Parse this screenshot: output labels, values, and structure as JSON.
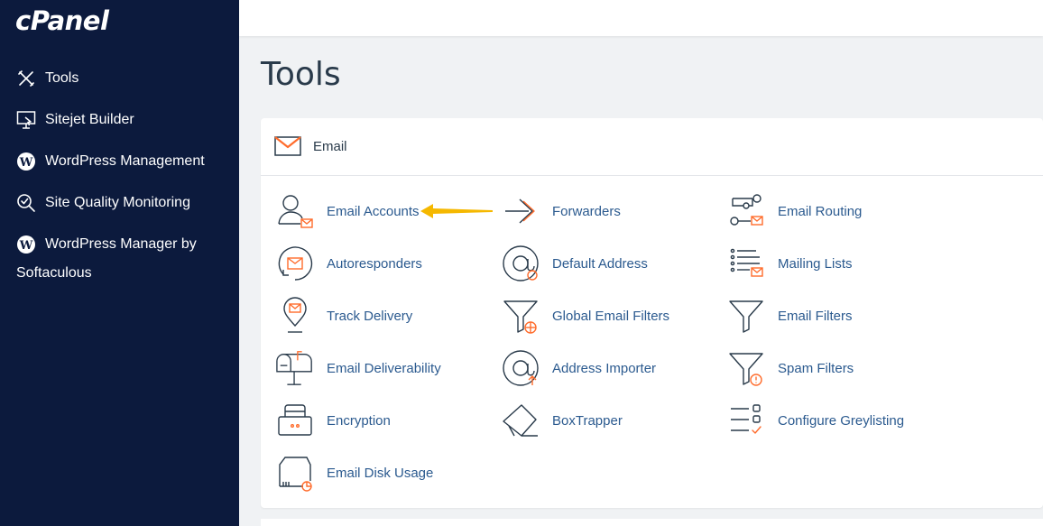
{
  "brand": {
    "logo_text": "cPanel"
  },
  "sidebar": {
    "items": [
      {
        "label": "Tools",
        "icon": "tools-icon"
      },
      {
        "label": "Sitejet Builder",
        "icon": "sitejet-icon"
      },
      {
        "label": "WordPress Management",
        "icon": "wordpress-icon"
      },
      {
        "label": "Site Quality Monitoring",
        "icon": "search-check-icon"
      },
      {
        "label": "WordPress Manager by",
        "label_line2": "Softaculous",
        "icon": "wordpress-icon"
      }
    ]
  },
  "page": {
    "title": "Tools"
  },
  "email_section": {
    "title": "Email",
    "icon": "envelope-icon",
    "accent_color": "#ff6c2c",
    "tools": [
      {
        "label": "Email Accounts",
        "icon": "email-accounts-icon"
      },
      {
        "label": "Forwarders",
        "icon": "forwarders-icon"
      },
      {
        "label": "Email Routing",
        "icon": "email-routing-icon"
      },
      {
        "label": "Autoresponders",
        "icon": "autoresponders-icon"
      },
      {
        "label": "Default Address",
        "icon": "default-address-icon"
      },
      {
        "label": "Mailing Lists",
        "icon": "mailing-lists-icon"
      },
      {
        "label": "Track Delivery",
        "icon": "track-delivery-icon"
      },
      {
        "label": "Global Email Filters",
        "icon": "global-filters-icon"
      },
      {
        "label": "Email Filters",
        "icon": "email-filters-icon"
      },
      {
        "label": "Email Deliverability",
        "icon": "mailbox-icon"
      },
      {
        "label": "Address Importer",
        "icon": "address-importer-icon"
      },
      {
        "label": "Spam Filters",
        "icon": "spam-filters-icon"
      },
      {
        "label": "Encryption",
        "icon": "encryption-icon"
      },
      {
        "label": "BoxTrapper",
        "icon": "boxtrapper-icon"
      },
      {
        "label": "Configure Greylisting",
        "icon": "greylisting-icon"
      },
      {
        "label": "Email Disk Usage",
        "icon": "disk-usage-icon"
      }
    ]
  },
  "annotation": {
    "arrow_color": "#f5b800"
  }
}
